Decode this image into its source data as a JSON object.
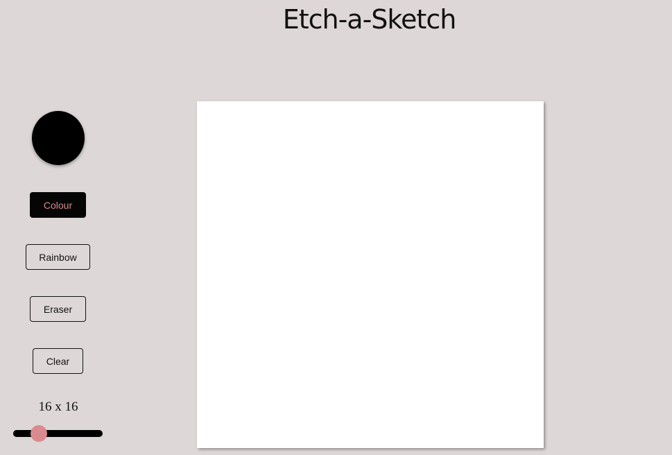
{
  "header": {
    "title": "Etch-a-Sketch"
  },
  "sidebar": {
    "color_picker": {
      "value": "#000000",
      "icon": "color-swatch"
    },
    "buttons": {
      "colour_label": "Colour",
      "rainbow_label": "Rainbow",
      "eraser_label": "Eraser",
      "clear_label": "Clear"
    },
    "active_mode": "Colour",
    "grid_size_label": "16 x 16",
    "slider": {
      "min": 1,
      "max": 64,
      "value": 16
    }
  },
  "colors": {
    "background": "#ddd7d7",
    "accent": "#d98a8e",
    "button_active_bg": "#050505",
    "canvas": "#ffffff"
  }
}
